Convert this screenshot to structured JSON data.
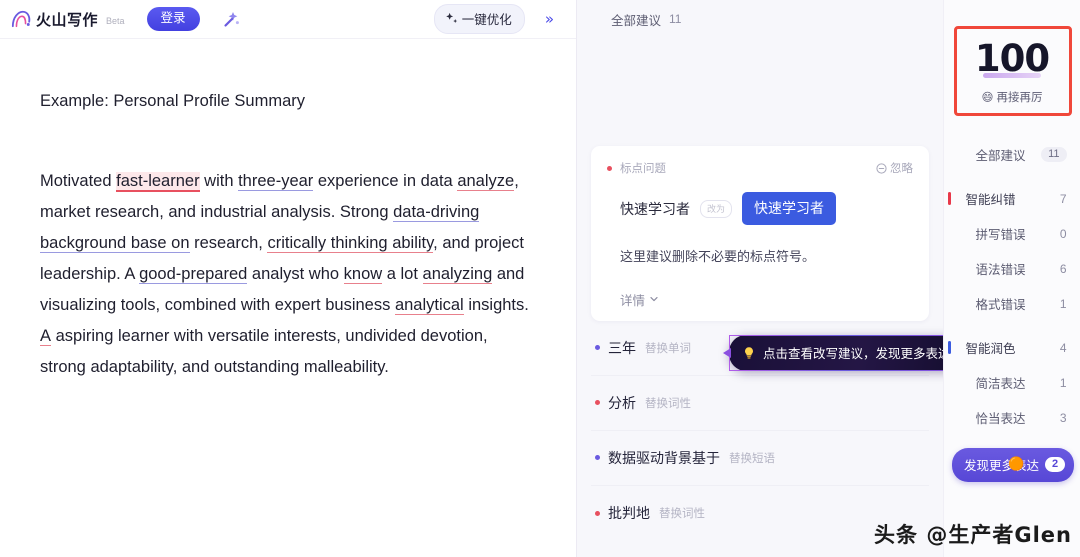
{
  "header": {
    "logo_text": "火山写作",
    "beta_tag": "Beta",
    "login_label": "登录",
    "magic_icon": "magic-wand-icon",
    "optimize_label": "一键优化",
    "optimize_icon": "sparkle-icon",
    "collapse_label": "»"
  },
  "editor": {
    "title": "Example: Personal Profile Summary",
    "paragraph_parts": [
      {
        "text": "Motivated ",
        "mark": "none"
      },
      {
        "text": "fast-learner",
        "mark": "error-red"
      },
      {
        "text": " with ",
        "mark": "none"
      },
      {
        "text": "three-year",
        "mark": "underline-blue"
      },
      {
        "text": " experience in data ",
        "mark": "none"
      },
      {
        "text": "analyze",
        "mark": "underline-red"
      },
      {
        "text": ", market research, and industrial analysis. Strong ",
        "mark": "none"
      },
      {
        "text": "data-driving background base on",
        "mark": "underline-blue"
      },
      {
        "text": " research, ",
        "mark": "none"
      },
      {
        "text": "critically thinking ability",
        "mark": "underline-red"
      },
      {
        "text": ", and project leadership. A ",
        "mark": "none"
      },
      {
        "text": "good-prepared",
        "mark": "underline-blue"
      },
      {
        "text": " analyst who ",
        "mark": "none"
      },
      {
        "text": "know",
        "mark": "underline-red"
      },
      {
        "text": " a lot ",
        "mark": "none"
      },
      {
        "text": "analyzing",
        "mark": "underline-red"
      },
      {
        "text": " and visualizing tools, combined with expert business ",
        "mark": "none"
      },
      {
        "text": "analytical",
        "mark": "underline-red"
      },
      {
        "text": " insights. ",
        "mark": "none"
      },
      {
        "text": "A",
        "mark": "underline-red"
      },
      {
        "text": " aspiring learner with versatile interests, undivided devotion, strong adaptability, and outstanding malleability.",
        "mark": "none"
      }
    ]
  },
  "suggestions": {
    "header_label": "全部建议",
    "header_count": "11",
    "card": {
      "kind": "标点问题",
      "ignore_label": "忽略",
      "ignore_icon": "circle-minus-icon",
      "from_text": "快速学习者",
      "arrow_label": "改为",
      "to_text": "快速学习者",
      "description": "这里建议删除不必要的标点符号。",
      "more_label": "详情",
      "more_icon": "chevron-down-icon"
    },
    "items": [
      {
        "word": "三年",
        "action": "替换单词",
        "dot": "purple"
      },
      {
        "word": "分析",
        "action": "替换词性",
        "dot": "red"
      },
      {
        "word": "数据驱动背景基于",
        "action": "替换短语",
        "dot": "purple"
      },
      {
        "word": "批判地",
        "action": "替换词性",
        "dot": "red"
      }
    ],
    "tooltip": {
      "icon": "lightbulb-icon",
      "text": "点击查看改写建议，发现更多表达"
    }
  },
  "score_panel": {
    "score": "100",
    "score_label": "再接再厉",
    "score_emoji": "emoji-grin-icon",
    "categories": [
      {
        "name": "全部建议",
        "count": "11",
        "type": "pill",
        "bar": "none",
        "group": false
      },
      {
        "name": "智能纠错",
        "count": "7",
        "type": "plain",
        "bar": "red",
        "group": true
      },
      {
        "name": "拼写错误",
        "count": "0",
        "type": "plain",
        "bar": "none",
        "group": false
      },
      {
        "name": "语法错误",
        "count": "6",
        "type": "plain",
        "bar": "none",
        "group": false
      },
      {
        "name": "格式错误",
        "count": "1",
        "type": "plain",
        "bar": "none",
        "group": false
      },
      {
        "name": "智能润色",
        "count": "4",
        "type": "plain",
        "bar": "blue",
        "group": true
      },
      {
        "name": "简洁表达",
        "count": "1",
        "type": "plain",
        "bar": "none",
        "group": false
      },
      {
        "name": "恰当表达",
        "count": "3",
        "type": "plain",
        "bar": "none",
        "group": false
      }
    ],
    "discover": {
      "label": "发现更多表达",
      "badge": "2",
      "emoji": "emoji-sun-icon"
    }
  },
  "watermark": {
    "text": "头条 @生产者Glen"
  },
  "colors": {
    "accent_purple": "#6a5ae0",
    "accent_blue": "#3b5be0",
    "error_red": "#e8384a",
    "annotation_red": "#f0473a",
    "panel_bg": "#f7f7fb"
  }
}
